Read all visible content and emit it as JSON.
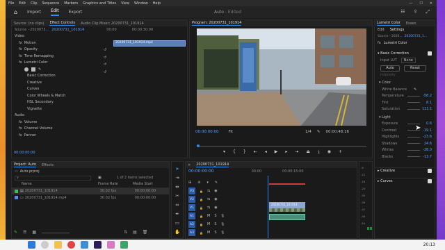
{
  "menu": [
    "File",
    "Edit",
    "Clip",
    "Sequence",
    "Markers",
    "Graphics and Titles",
    "View",
    "Window",
    "Help"
  ],
  "topbar": {
    "tabs": [
      "Import",
      "Edit",
      "Export"
    ],
    "active": "Edit",
    "title": "Auto",
    "title_suffix": "- Edited"
  },
  "source": {
    "tabs": [
      "Source: (no clips)",
      "Effect Controls",
      "Audio Clip Mixer: 20200731_101914"
    ],
    "active_tab": "Effect Controls",
    "header_left": "Source - 2020073...",
    "header_seq": "20200731_101914",
    "timecode_start": "00:00",
    "timecode_end": "00:00:30:00",
    "clip_name": "20200731_101914.mp4",
    "video_label": "Video",
    "effects": [
      "Motion",
      "Opacity",
      "Time Remapping",
      "Lumetri Color"
    ],
    "lumetri_sub": [
      "Basic Correction",
      "Creative",
      "Curves",
      "Color Wheels & Match",
      "HSL Secondary",
      "Vignette"
    ],
    "audio_label": "Audio",
    "audio_effects": [
      "Volume",
      "Channel Volume",
      "Panner"
    ],
    "bottom_time": "00:00:00:00"
  },
  "program": {
    "title": "Program: 20200731_101914",
    "timecode": "00:00:00:00",
    "fit": "Fit",
    "scale": "1/4",
    "duration": "00:00:48:16"
  },
  "project": {
    "tabs": [
      "Project: Auto",
      "Effects"
    ],
    "file": "Auto.prproj",
    "count": "1 of 2 items selected",
    "columns": [
      "Name",
      "Frame Rate",
      "Media Start"
    ],
    "rows": [
      {
        "name": "20200731_101914",
        "rate": "30.02 fps",
        "start": "00:00:00:00"
      },
      {
        "name": "20200731_101914.mp4",
        "rate": "30.02 fps",
        "start": "00:00:00:00"
      }
    ]
  },
  "timeline": {
    "seq": "20200731_101914",
    "timecode": "00:00:00:00",
    "ruler": [
      "00:00",
      "00:00:15:00"
    ],
    "video_tracks": [
      "V3",
      "V2",
      "V1"
    ],
    "audio_tracks": [
      "A1",
      "A2",
      "A3"
    ],
    "clip_video": "20200731_101914",
    "meter_db": [
      "-6",
      "-12",
      "-18",
      "-24",
      "-30",
      "-36",
      "-42",
      "-48",
      "-54"
    ]
  },
  "lumetri": {
    "tabs": [
      "Lumetri Color",
      "Essen"
    ],
    "subtabs": [
      "Edit",
      "Settings"
    ],
    "source": "Source - 2020...",
    "seq": "20200731_1...",
    "effect": "Lumetri Color",
    "basic": "Basic Correction",
    "input_lut_label": "Input LUT",
    "input_lut_value": "None",
    "auto": "Auto",
    "reset": "Reset",
    "intensity": "Intensity",
    "color_label": "Color",
    "white_balance": "White Balance",
    "params_color": [
      {
        "label": "Temperature",
        "value": "-58.2"
      },
      {
        "label": "Tint",
        "value": "8.1"
      },
      {
        "label": "Saturation",
        "value": "111.1"
      }
    ],
    "light_label": "Light",
    "params_light": [
      {
        "label": "Exposure",
        "value": "0.6"
      },
      {
        "label": "Contrast",
        "value": "-19.1"
      },
      {
        "label": "Highlights",
        "value": "-23.6"
      },
      {
        "label": "Shadows",
        "value": "24.6"
      },
      {
        "label": "Whites",
        "value": "-28.0"
      },
      {
        "label": "Blacks",
        "value": "-13.7"
      }
    ],
    "creative": "Creative",
    "curves": "Curves"
  },
  "taskbar": {
    "clock": "20:13"
  }
}
